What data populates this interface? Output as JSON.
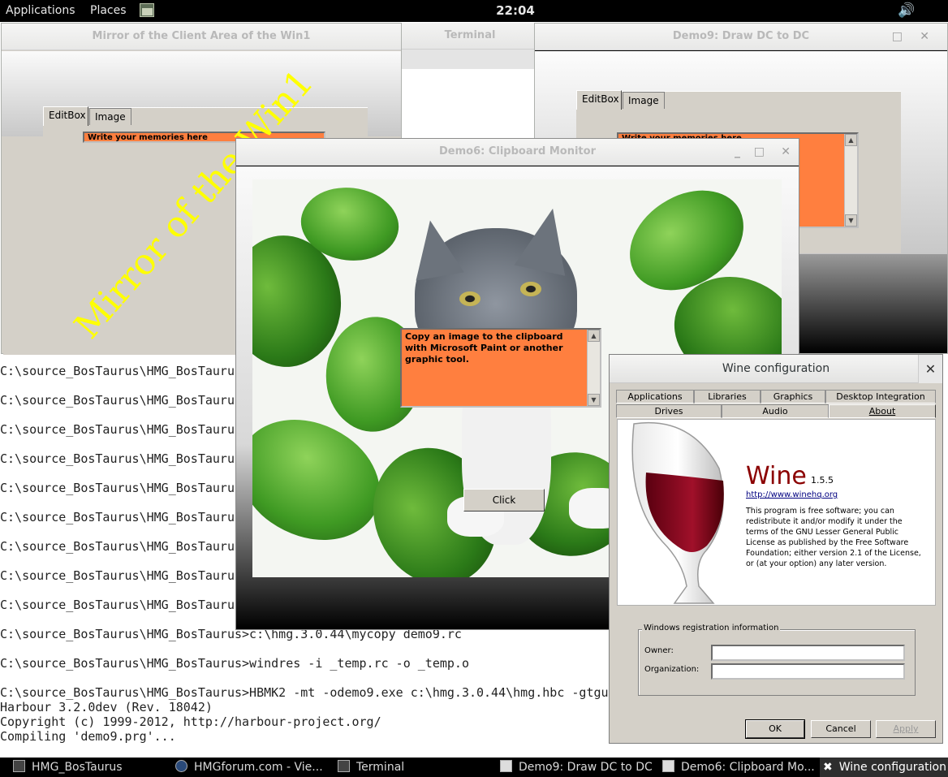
{
  "top_panel": {
    "applications": "Applications",
    "places": "Places",
    "clock": "22:04"
  },
  "terminal": {
    "lines": [
      "C:\\source_BosTaurus\\HMG_BosTaurus>",
      "C:\\source_BosTaurus\\HMG_BosTaurus>",
      "C:\\source_BosTaurus\\HMG_BosTaurus>",
      "C:\\source_BosTaurus\\HMG_BosTaurus>",
      "C:\\source_BosTaurus\\HMG_BosTaurus>",
      "C:\\source_BosTaurus\\HMG_BosTaurus>",
      "C:\\source_BosTaurus\\HMG_BosTaurus>",
      "C:\\source_BosTaurus\\HMG_BosTaurus>",
      "C:\\source_BosTaurus\\HMG_BosTaurus>",
      "C:\\source_BosTaurus\\HMG_BosTaurus>c:\\hmg.3.0.44\\mycopy demo9.rc",
      "C:\\source_BosTaurus\\HMG_BosTaurus>windres -i _temp.rc -o _temp.o",
      "C:\\source_BosTaurus\\HMG_BosTaurus>HBMK2 -mt -odemo9.exe c:\\hmg.3.0.44\\hmg.hbc -gtgui",
      "Harbour 3.2.0dev (Rev. 18042)",
      "Copyright (c) 1999-2012, http://harbour-project.org/",
      "Compiling 'demo9.prg'..."
    ]
  },
  "mirror_window": {
    "title": "Mirror of the Client Area of the Win1",
    "tab_editbox": "EditBox",
    "tab_image": "Image",
    "memo_text": "Write your memories here",
    "overlay_text": "Mirror of the Win1"
  },
  "terminal_window": {
    "title": "Terminal"
  },
  "demo9_window": {
    "title": "Demo9: Draw DC to DC",
    "tab_editbox": "EditBox",
    "tab_image": "Image",
    "memo_text": "Write your memories here"
  },
  "demo6_window": {
    "title": "Demo6: Clipboard Monitor",
    "memo_text": "Copy an image to the clipboard with Microsoft Paint or another graphic tool.",
    "click_button": "Click"
  },
  "wine_window": {
    "title": "Wine configuration",
    "tabs_row1": [
      "Applications",
      "Libraries",
      "Graphics",
      "Desktop Integration"
    ],
    "tabs_row2": [
      "Drives",
      "Audio",
      "About"
    ],
    "active_tab": "About",
    "app_name": "Wine",
    "version": "1.5.5",
    "url": "http://www.winehq.org",
    "license_text": "This program is free software; you can redistribute it and/or modify it under the terms of the GNU Lesser General Public License as published by the Free Software Foundation; either version 2.1 of the License, or (at your option) any later version.",
    "reg_group": "Windows registration information",
    "owner_label": "Owner:",
    "owner_value": "",
    "org_label": "Organization:",
    "org_value": "",
    "ok": "OK",
    "cancel": "Cancel",
    "apply": "Apply",
    "close_glyph": "✕"
  },
  "taskbar": {
    "items": [
      "HMG_BosTaurus",
      "HMGforum.com - Vie...",
      "Terminal",
      "Demo9: Draw DC to DC",
      "Demo6: Clipboard Mo...",
      "Wine configuration"
    ]
  },
  "colors": {
    "memo_orange": "#ff7f3f",
    "overlay_yellow": "#ffff00",
    "wine_red": "#8b0000"
  }
}
